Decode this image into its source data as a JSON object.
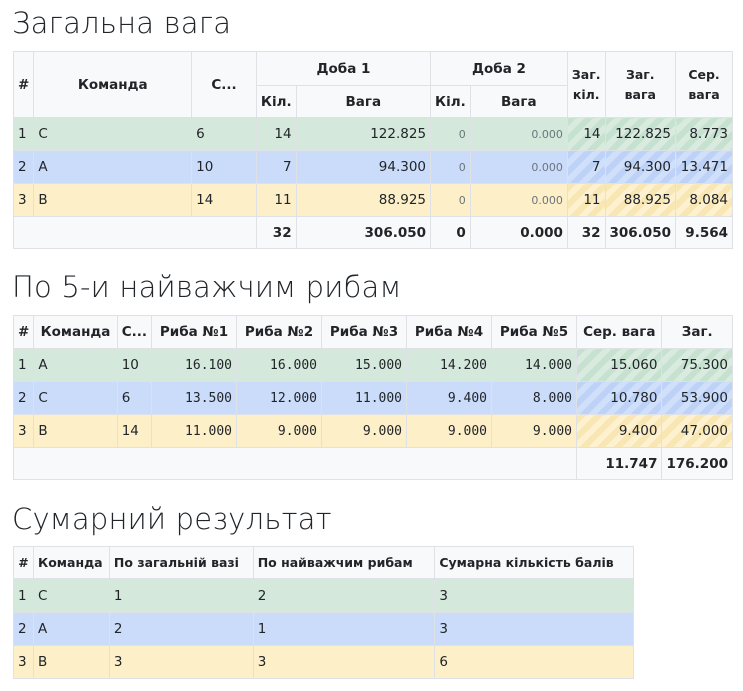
{
  "section1": {
    "title": "Загальна вага",
    "headers": {
      "num": "#",
      "team": "Команда",
      "sector": "С...",
      "day1": "Доба 1",
      "day2": "Доба 2",
      "count": "Кіл.",
      "weight": "Вага",
      "total_count": "Заг. кіл.",
      "total_weight": "Заг. вага",
      "avg_weight": "Сер. вага"
    },
    "rows": [
      {
        "num": "1",
        "team": "C",
        "sector": "6",
        "d1_count": "14",
        "d1_weight": "122.825",
        "d2_count": "0",
        "d2_weight": "0.000",
        "tot_count": "14",
        "tot_weight": "122.825",
        "avg": "8.773",
        "color": "green"
      },
      {
        "num": "2",
        "team": "A",
        "sector": "10",
        "d1_count": "7",
        "d1_weight": "94.300",
        "d2_count": "0",
        "d2_weight": "0.000",
        "tot_count": "7",
        "tot_weight": "94.300",
        "avg": "13.471",
        "color": "blue"
      },
      {
        "num": "3",
        "team": "B",
        "sector": "14",
        "d1_count": "11",
        "d1_weight": "88.925",
        "d2_count": "0",
        "d2_weight": "0.000",
        "tot_count": "11",
        "tot_weight": "88.925",
        "avg": "8.084",
        "color": "yellow"
      }
    ],
    "totals": {
      "d1_count": "32",
      "d1_weight": "306.050",
      "d2_count": "0",
      "d2_weight": "0.000",
      "tot_count": "32",
      "tot_weight": "306.050",
      "avg": "9.564"
    }
  },
  "section2": {
    "title": "По 5-и найважчим рибам",
    "headers": {
      "num": "#",
      "team": "Команда",
      "sector": "С...",
      "fish1": "Риба №1",
      "fish2": "Риба №2",
      "fish3": "Риба №3",
      "fish4": "Риба №4",
      "fish5": "Риба №5",
      "avg": "Сер. вага",
      "total": "Заг."
    },
    "rows": [
      {
        "num": "1",
        "team": "A",
        "sector": "10",
        "f1": "16.100",
        "f2": "16.000",
        "f3": "15.000",
        "f4": "14.200",
        "f5": "14.000",
        "avg": "15.060",
        "total": "75.300"
      },
      {
        "num": "2",
        "team": "C",
        "sector": "6",
        "f1": "13.500",
        "f2": "12.000",
        "f3": "11.000",
        "f4": "9.400",
        "f5": "8.000",
        "avg": "10.780",
        "total": "53.900"
      },
      {
        "num": "3",
        "team": "B",
        "sector": "14",
        "f1": "11.000",
        "f2": "9.000",
        "f3": "9.000",
        "f4": "9.000",
        "f5": "9.000",
        "avg": "9.400",
        "total": "47.000"
      }
    ],
    "totals": {
      "avg": "11.747",
      "total": "176.200"
    }
  },
  "section3": {
    "title": "Сумарний результат",
    "headers": {
      "num": "#",
      "team": "Команда",
      "by_weight": "По загальній вазі",
      "by_fish": "По найважчим рибам",
      "points": "Сумарна кількість балів"
    },
    "rows": [
      {
        "num": "1",
        "team": "C",
        "by_weight": "1",
        "by_fish": "2",
        "points": "3"
      },
      {
        "num": "2",
        "team": "A",
        "by_weight": "2",
        "by_fish": "1",
        "points": "3"
      },
      {
        "num": "3",
        "team": "B",
        "by_weight": "3",
        "by_fish": "3",
        "points": "6"
      }
    ]
  }
}
